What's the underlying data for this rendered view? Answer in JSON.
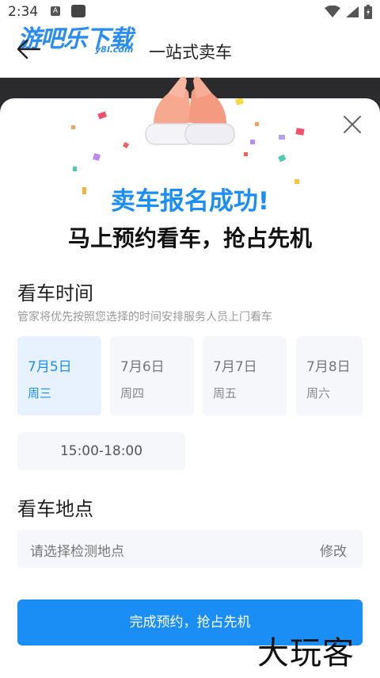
{
  "status_bar": {
    "time": "2:34",
    "notif_letter": "A"
  },
  "header": {
    "logo_main": "游吧乐下载",
    "logo_sub": "y8l.com",
    "title": "一站式卖车"
  },
  "sheet": {
    "success_title": "卖车报名成功!",
    "success_subtitle": "马上预约看车，抢占先机",
    "time_section": {
      "title": "看车时间",
      "hint": "管家将优先按照您选择的时间安排服务人员上门看车",
      "dates": [
        {
          "date": "7月5日",
          "weekday": "周三",
          "selected": true
        },
        {
          "date": "7月6日",
          "weekday": "周四",
          "selected": false
        },
        {
          "date": "7月7日",
          "weekday": "周五",
          "selected": false
        },
        {
          "date": "7月8日",
          "weekday": "周六",
          "selected": false
        }
      ],
      "time_slot": "15:00-18:00"
    },
    "place_section": {
      "title": "看车地点",
      "placeholder": "请选择检测地点",
      "edit_label": "修改"
    },
    "submit_label": "完成预约，抢占先机"
  },
  "watermark": "大玩客",
  "colors": {
    "accent": "#1a8ef5",
    "selected_bg": "#e7f2fe",
    "field_bg": "#f5f7fa"
  }
}
